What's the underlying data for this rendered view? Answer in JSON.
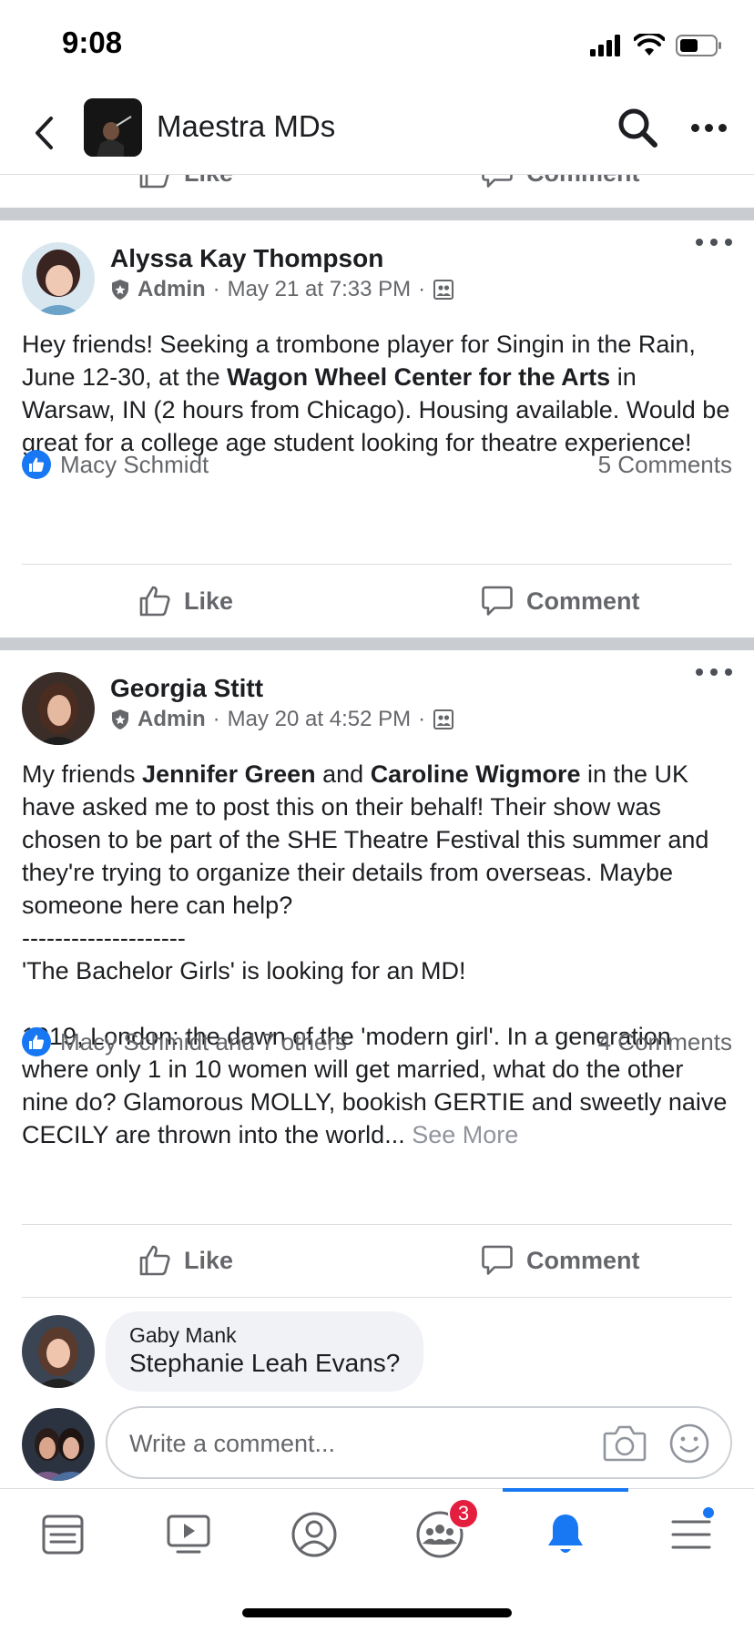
{
  "status_bar": {
    "time": "9:08"
  },
  "header": {
    "title": "Maestra MDs"
  },
  "actions": {
    "like": "Like",
    "comment": "Comment"
  },
  "posts": [
    {
      "author": "Alyssa Kay Thompson",
      "role": "Admin",
      "sep": "·",
      "timestamp": "May 21 at 7:33 PM",
      "body": {
        "p1": "Hey friends! Seeking a trombone player for Singin in the Rain, June 12-30, at the ",
        "b1": "Wagon Wheel Center for the Arts",
        "p2": " in Warsaw, IN (2 hours from Chicago). Housing available. Would be great for a college age student looking for theatre experience!"
      },
      "reactors": "Macy Schmidt",
      "comments_count": "5 Comments"
    },
    {
      "author": "Georgia Stitt",
      "role": "Admin",
      "sep": "·",
      "timestamp": "May 20 at 4:52 PM",
      "body": {
        "p1": "My friends ",
        "b1": "Jennifer Green",
        "p2": " and ",
        "b2": "Caroline Wigmore",
        "p3": " in the UK have asked me to post this on their behalf! Their show was chosen to be part of the SHE Theatre Festival this summer and they're trying to organize their details from overseas. Maybe someone here can help?",
        "line2": "--------------------",
        "line3": "'The Bachelor Girls' is looking for an MD!",
        "line4": "1919, London: the dawn of the 'modern girl'. In a generation where only 1 in 10 women will get married, what do the other nine do? Glamorous MOLLY, bookish GERTIE and sweetly naive CECILY are thrown into the world...",
        "see_more": "See More"
      },
      "reactors": "Macy Schmidt and 7 others",
      "comments_count": "4 Comments",
      "comment": {
        "name": "Gaby Mank",
        "text": "Stephanie Leah Evans?"
      },
      "write_placeholder": "Write a comment..."
    }
  ],
  "tab_bar": {
    "items": [
      "news-feed",
      "watch",
      "profile",
      "groups",
      "notifications",
      "menu"
    ],
    "groups_badge": "3",
    "active": "notifications"
  },
  "colors": {
    "accent": "#1877f2",
    "badge": "#e41e3f",
    "secondary_text": "#65676b"
  }
}
